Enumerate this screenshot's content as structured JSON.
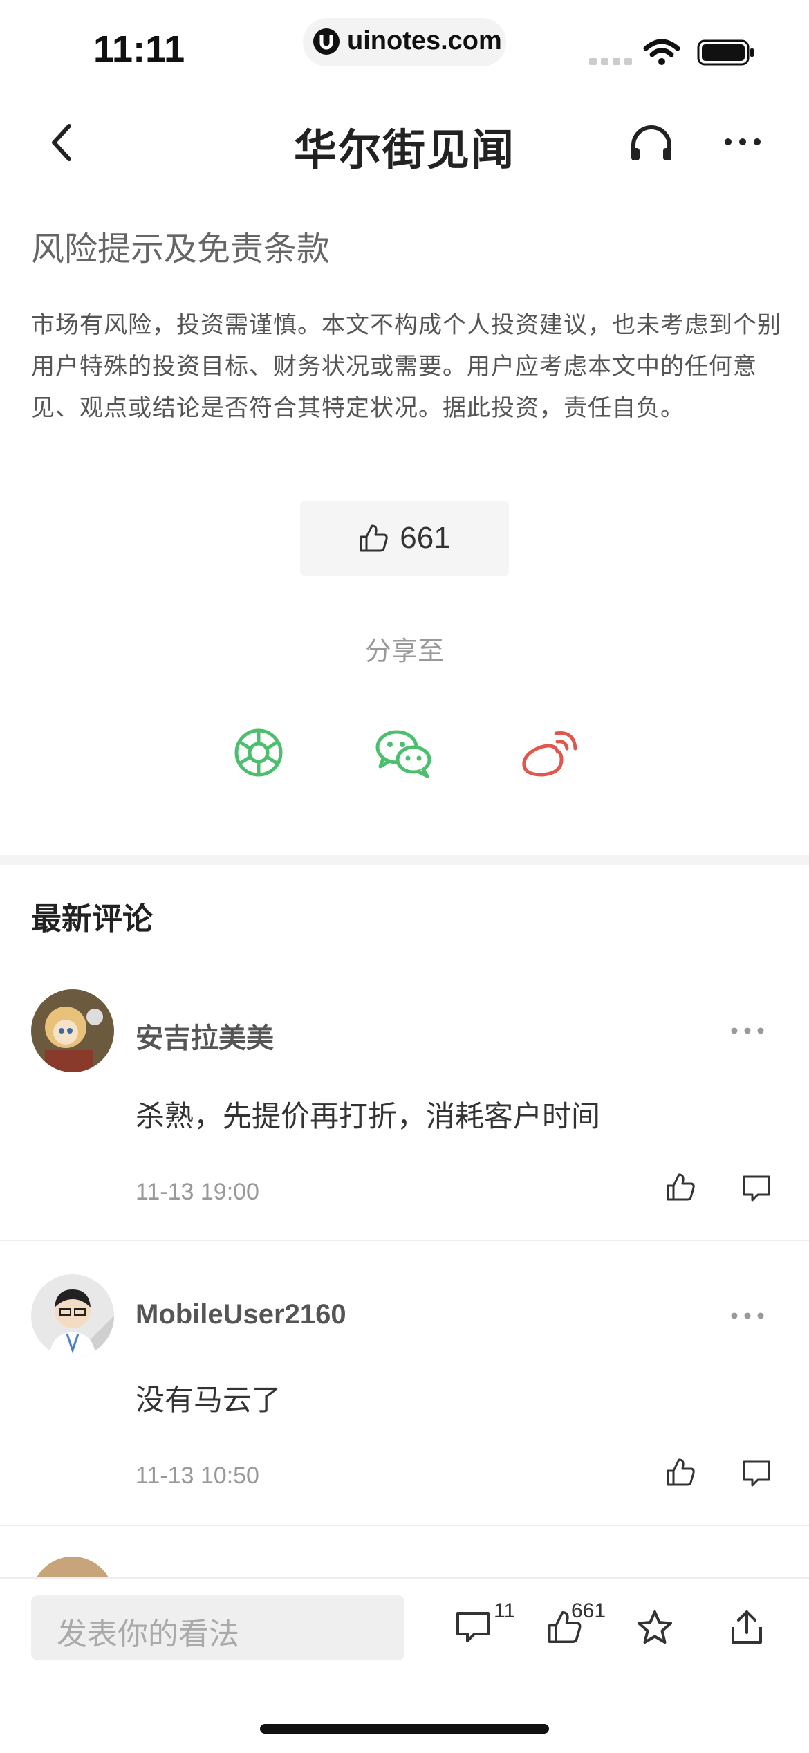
{
  "status_bar": {
    "time": "11:11",
    "url": "uinotes.com"
  },
  "header": {
    "brand": "华尔街见闻"
  },
  "disclaimer": {
    "title": "风险提示及免责条款",
    "body": "市场有风险，投资需谨慎。本文不构成个人投资建议，也未考虑到个别用户特殊的投资目标、财务状况或需要。用户应考虑本文中的任何意见、观点或结论是否符合其特定状况。据此投资，责任自负。"
  },
  "like": {
    "count": "661"
  },
  "share": {
    "label": "分享至",
    "icons": [
      "moments-icon",
      "wechat-icon",
      "weibo-icon"
    ],
    "colors": {
      "green": "#4cbf6e",
      "red": "#e0574f"
    }
  },
  "comments_section": {
    "title": "最新评论",
    "items": [
      {
        "name": "安吉拉美美",
        "text": "杀熟，先提价再打折，消耗客户时间",
        "time": "11-13 19:00"
      },
      {
        "name": "MobileUser2160",
        "text": "没有马云了",
        "time": "11-13 10:50"
      }
    ]
  },
  "bottom_bar": {
    "placeholder": "发表你的看法",
    "comment_count": "11",
    "like_count": "661"
  }
}
